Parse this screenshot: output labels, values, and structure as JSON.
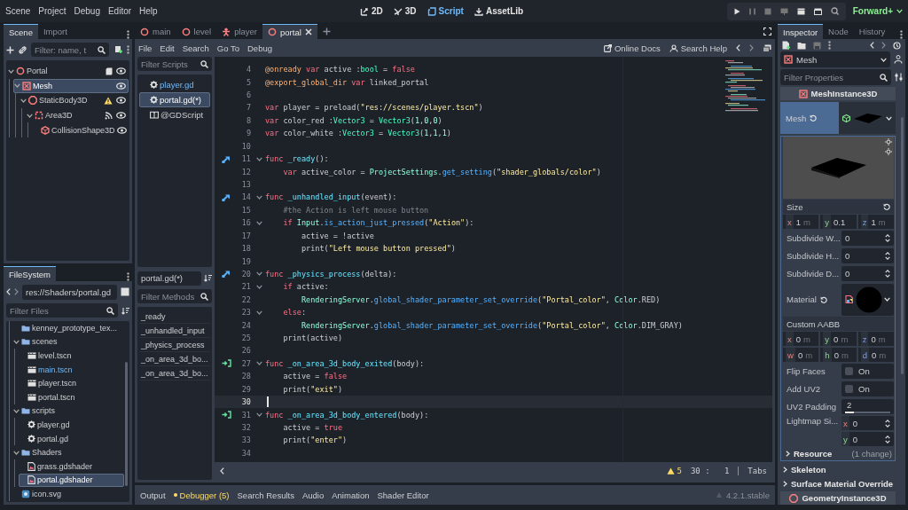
{
  "menu_bar": {
    "menus": [
      "Scene",
      "Project",
      "Debug",
      "Editor",
      "Help"
    ],
    "workspaces": [
      {
        "label": "2D",
        "kind": "canvas",
        "selected": false
      },
      {
        "label": "3D",
        "kind": "spatial",
        "selected": false
      },
      {
        "label": "Script",
        "kind": "script",
        "selected": true
      },
      {
        "label": "AssetLib",
        "kind": "assetlib",
        "selected": false
      }
    ],
    "renderer": "Forward+"
  },
  "scene_dock": {
    "tabs": [
      {
        "label": "Scene",
        "selected": true
      },
      {
        "label": "Import",
        "selected": false
      }
    ],
    "filter": {
      "placeholder": "Filter: name, t"
    },
    "tree": [
      {
        "label": "Portal",
        "kind": "node3d",
        "badge": {
          "kind": "script"
        },
        "selected": false,
        "expanded": true,
        "children": [
          {
            "label": "Mesh",
            "kind": "mesh",
            "selected": true,
            "expanded": true,
            "children": [
              {
                "label": "StaticBody3D",
                "kind": "body",
                "badge": {
                  "kind": "warning"
                },
                "selected": false,
                "expanded": true,
                "children": [
                  {
                    "label": "Area3D",
                    "kind": "area",
                    "badge": {
                      "kind": "signal"
                    },
                    "selected": false,
                    "expanded": true,
                    "children": [
                      {
                        "label": "CollisionShape3D",
                        "kind": "collision",
                        "selected": false
                      }
                    ]
                  }
                ]
              }
            ]
          }
        ]
      }
    ]
  },
  "filesystem": {
    "tabs": [
      {
        "label": "FileSystem",
        "selected": true
      }
    ],
    "path": "res://Shaders/portal.gd",
    "filter": {
      "placeholder": "Filter Files"
    },
    "tree": [
      {
        "label": "kenney_prototype_tex...",
        "kind": "folder",
        "selected": false,
        "highlighted": false
      },
      {
        "label": "scenes",
        "kind": "folder",
        "selected": false,
        "highlighted": false,
        "expanded": true,
        "children": [
          {
            "label": "level.tscn",
            "kind": "scene",
            "selected": false,
            "highlighted": false
          },
          {
            "label": "main.tscn",
            "kind": "scene",
            "selected": false,
            "highlighted": true
          },
          {
            "label": "player.tscn",
            "kind": "scene",
            "selected": false,
            "highlighted": false
          },
          {
            "label": "portal.tscn",
            "kind": "scene",
            "selected": false,
            "highlighted": false
          }
        ]
      },
      {
        "label": "scripts",
        "kind": "folder",
        "selected": false,
        "highlighted": false,
        "expanded": true,
        "children": [
          {
            "label": "player.gd",
            "kind": "script",
            "selected": false,
            "highlighted": false
          },
          {
            "label": "portal.gd",
            "kind": "script",
            "selected": false,
            "highlighted": false
          }
        ]
      },
      {
        "label": "Shaders",
        "kind": "folder",
        "selected": false,
        "highlighted": false,
        "expanded": true,
        "children": [
          {
            "label": "grass.gdshader",
            "kind": "shader",
            "selected": false,
            "highlighted": false
          },
          {
            "label": "portal.gdshader",
            "kind": "shader",
            "selected": true,
            "highlighted": false
          }
        ]
      },
      {
        "label": "icon.svg",
        "kind": "image",
        "selected": false,
        "highlighted": false
      }
    ]
  },
  "script_editor": {
    "scene_tabs": [
      {
        "label": "main",
        "kind": "node3d",
        "selected": false
      },
      {
        "label": "level",
        "kind": "node3d",
        "selected": false
      },
      {
        "label": "player",
        "kind": "character",
        "selected": false
      },
      {
        "label": "portal",
        "kind": "node3d",
        "selected": true
      }
    ],
    "menus": [
      "File",
      "Edit",
      "Search",
      "Go To",
      "Debug"
    ],
    "help_links": [
      {
        "label": "Online Docs",
        "kind": "docs"
      },
      {
        "label": "Search Help",
        "kind": "help"
      }
    ],
    "script_filter": {
      "placeholder": "Filter Scripts"
    },
    "scripts": [
      {
        "label": "player.gd",
        "kind": "script",
        "selected": false,
        "highlighted": true
      },
      {
        "label": "portal.gd(*)",
        "kind": "script",
        "selected": true,
        "highlighted": false
      },
      {
        "label": "@GDScript",
        "kind": "doc",
        "selected": false,
        "highlighted": false
      }
    ],
    "current_script": "portal.gd(*)",
    "method_filter": {
      "placeholder": "Filter Methods"
    },
    "methods": [
      "_ready",
      "_unhandled_input",
      "_physics_process",
      "_on_area_3d_bo...",
      "_on_area_3d_bo..."
    ],
    "code_lines": [
      {
        "number": "4",
        "fold": false,
        "current": false,
        "tokens": [
          {
            "kind": "ann",
            "text": "@onready"
          },
          {
            "kind": "kw",
            "text": " var"
          },
          {
            "kind": "text",
            "text": " active :"
          },
          {
            "kind": "type",
            "text": "bool"
          },
          {
            "kind": "text",
            "text": " = "
          },
          {
            "kind": "kw",
            "text": "false"
          }
        ]
      },
      {
        "number": "5",
        "fold": false,
        "current": false,
        "tokens": [
          {
            "kind": "ann",
            "text": "@export_global_dir"
          },
          {
            "kind": "kw",
            "text": " var"
          },
          {
            "kind": "text",
            "text": " linked_portal"
          }
        ]
      },
      {
        "number": "6",
        "fold": false,
        "current": false
      },
      {
        "number": "7",
        "fold": false,
        "current": false,
        "tokens": [
          {
            "kind": "kw",
            "text": "var"
          },
          {
            "kind": "text",
            "text": " player = preload("
          },
          {
            "kind": "str",
            "text": "\"res://scenes/player.tscn\""
          },
          {
            "kind": "text",
            "text": ")"
          }
        ]
      },
      {
        "number": "8",
        "fold": false,
        "current": false,
        "tokens": [
          {
            "kind": "kw",
            "text": "var"
          },
          {
            "kind": "text",
            "text": " color_red :"
          },
          {
            "kind": "type",
            "text": "Vector3"
          },
          {
            "kind": "text",
            "text": " = "
          },
          {
            "kind": "type",
            "text": "Vector3"
          },
          {
            "kind": "text",
            "text": "("
          },
          {
            "kind": "num",
            "text": "1"
          },
          {
            "kind": "text",
            "text": ","
          },
          {
            "kind": "num",
            "text": "0"
          },
          {
            "kind": "text",
            "text": ","
          },
          {
            "kind": "num",
            "text": "0"
          },
          {
            "kind": "text",
            "text": ")"
          }
        ]
      },
      {
        "number": "9",
        "fold": false,
        "current": false,
        "tokens": [
          {
            "kind": "kw",
            "text": "var"
          },
          {
            "kind": "text",
            "text": " color_white :"
          },
          {
            "kind": "type",
            "text": "Vector3"
          },
          {
            "kind": "text",
            "text": " = "
          },
          {
            "kind": "type",
            "text": "Vector3"
          },
          {
            "kind": "text",
            "text": "("
          },
          {
            "kind": "num",
            "text": "1"
          },
          {
            "kind": "text",
            "text": ","
          },
          {
            "kind": "num",
            "text": "1"
          },
          {
            "kind": "text",
            "text": ","
          },
          {
            "kind": "num",
            "text": "1"
          },
          {
            "kind": "text",
            "text": ")"
          }
        ]
      },
      {
        "number": "10",
        "fold": false,
        "current": false
      },
      {
        "number": "11",
        "fold": true,
        "current": false,
        "gutter_icon": {
          "kind": "override"
        },
        "tokens": [
          {
            "kind": "kw",
            "text": "func"
          },
          {
            "kind": "fndef",
            "text": " _ready"
          },
          {
            "kind": "text",
            "text": "():"
          }
        ]
      },
      {
        "number": "12",
        "fold": false,
        "current": false,
        "tokens": [
          {
            "kind": "kw",
            "text": "\tvar"
          },
          {
            "kind": "text",
            "text": " active_color = "
          },
          {
            "kind": "engine",
            "text": "ProjectSettings"
          },
          {
            "kind": "text",
            "text": "."
          },
          {
            "kind": "fn",
            "text": "get_setting"
          },
          {
            "kind": "text",
            "text": "("
          },
          {
            "kind": "str",
            "text": "\"shader_globals/color\""
          },
          {
            "kind": "text",
            "text": ")"
          }
        ]
      },
      {
        "number": "13",
        "fold": false,
        "current": false
      },
      {
        "number": "14",
        "fold": true,
        "current": false,
        "gutter_icon": {
          "kind": "override"
        },
        "tokens": [
          {
            "kind": "kw",
            "text": "func"
          },
          {
            "kind": "fndef",
            "text": " _unhandled_input"
          },
          {
            "kind": "text",
            "text": "(event):"
          }
        ]
      },
      {
        "number": "15",
        "fold": false,
        "current": false,
        "tokens": [
          {
            "kind": "comment",
            "text": "\t#the Action is left mouse button"
          }
        ]
      },
      {
        "number": "16",
        "fold": true,
        "current": false,
        "tokens": [
          {
            "kind": "kw",
            "text": "\tif"
          },
          {
            "kind": "engine",
            "text": " Input"
          },
          {
            "kind": "text",
            "text": "."
          },
          {
            "kind": "fn",
            "text": "is_action_just_pressed"
          },
          {
            "kind": "text",
            "text": "("
          },
          {
            "kind": "str",
            "text": "\"Action\""
          },
          {
            "kind": "text",
            "text": "):"
          }
        ]
      },
      {
        "number": "17",
        "fold": false,
        "current": false,
        "tokens": [
          {
            "kind": "text",
            "text": "\t\tactive = !active"
          }
        ]
      },
      {
        "number": "18",
        "fold": false,
        "current": false,
        "tokens": [
          {
            "kind": "text",
            "text": "\t\tprint("
          },
          {
            "kind": "str",
            "text": "\"Left mouse button pressed\""
          },
          {
            "kind": "text",
            "text": ")"
          }
        ]
      },
      {
        "number": "19",
        "fold": false,
        "current": false
      },
      {
        "number": "20",
        "fold": true,
        "current": false,
        "gutter_icon": {
          "kind": "override"
        },
        "tokens": [
          {
            "kind": "kw",
            "text": "func"
          },
          {
            "kind": "fndef",
            "text": " _physics_process"
          },
          {
            "kind": "text",
            "text": "(delta):"
          }
        ]
      },
      {
        "number": "21",
        "fold": true,
        "current": false,
        "tokens": [
          {
            "kind": "kw",
            "text": "\tif"
          },
          {
            "kind": "text",
            "text": " active:"
          }
        ]
      },
      {
        "number": "22",
        "fold": false,
        "current": false,
        "tokens": [
          {
            "kind": "engine",
            "text": "\t\tRenderingServer"
          },
          {
            "kind": "text",
            "text": "."
          },
          {
            "kind": "fn",
            "text": "global_shader_parameter_set_override"
          },
          {
            "kind": "text",
            "text": "("
          },
          {
            "kind": "str",
            "text": "\"Portal_color\""
          },
          {
            "kind": "text",
            "text": ", "
          },
          {
            "kind": "engine",
            "text": "Color"
          },
          {
            "kind": "text",
            "text": ".RED)"
          }
        ]
      },
      {
        "number": "23",
        "fold": true,
        "current": false,
        "tokens": [
          {
            "kind": "kw",
            "text": "\telse"
          },
          {
            "kind": "text",
            "text": ":"
          }
        ]
      },
      {
        "number": "24",
        "fold": false,
        "current": false,
        "tokens": [
          {
            "kind": "engine",
            "text": "\t\tRenderingServer"
          },
          {
            "kind": "text",
            "text": "."
          },
          {
            "kind": "fn",
            "text": "global_shader_parameter_set_override"
          },
          {
            "kind": "text",
            "text": "("
          },
          {
            "kind": "str",
            "text": "\"Portal_color\""
          },
          {
            "kind": "text",
            "text": ", "
          },
          {
            "kind": "engine",
            "text": "Color"
          },
          {
            "kind": "text",
            "text": ".DIM_GRAY)"
          }
        ]
      },
      {
        "number": "25",
        "fold": false,
        "current": false,
        "tokens": [
          {
            "kind": "text",
            "text": "\tprint(active)"
          }
        ]
      },
      {
        "number": "26",
        "fold": false,
        "current": false
      },
      {
        "number": "27",
        "fold": true,
        "current": false,
        "gutter_icon": {
          "kind": "signal"
        },
        "tokens": [
          {
            "kind": "kw",
            "text": "func"
          },
          {
            "kind": "fndef",
            "text": " _on_area_3d_body_exited"
          },
          {
            "kind": "text",
            "text": "(body):"
          }
        ]
      },
      {
        "number": "28",
        "fold": false,
        "current": false,
        "tokens": [
          {
            "kind": "text",
            "text": "\tactive = "
          },
          {
            "kind": "kw",
            "text": "false"
          }
        ]
      },
      {
        "number": "29",
        "fold": false,
        "current": false,
        "tokens": [
          {
            "kind": "text",
            "text": "\tprint("
          },
          {
            "kind": "str",
            "text": "\"exit\""
          },
          {
            "kind": "text",
            "text": ")"
          }
        ]
      },
      {
        "number": "30",
        "fold": false,
        "current": true
      },
      {
        "number": "31",
        "fold": true,
        "current": false,
        "gutter_icon": {
          "kind": "signal"
        },
        "tokens": [
          {
            "kind": "kw",
            "text": "func"
          },
          {
            "kind": "fndef",
            "text": " _on_area_3d_body_entered"
          },
          {
            "kind": "text",
            "text": "(body):"
          }
        ]
      },
      {
        "number": "32",
        "fold": false,
        "current": false,
        "tokens": [
          {
            "kind": "text",
            "text": "\tactive = "
          },
          {
            "kind": "kw",
            "text": "true"
          }
        ]
      },
      {
        "number": "33",
        "fold": false,
        "current": false,
        "tokens": [
          {
            "kind": "text",
            "text": "\tprint("
          },
          {
            "kind": "str",
            "text": "\"enter\""
          },
          {
            "kind": "text",
            "text": ")"
          }
        ]
      },
      {
        "number": "34",
        "fold": false,
        "current": false
      }
    ],
    "status": {
      "warnings": "5",
      "position": "30 :   1",
      "indentation": "Tabs"
    }
  },
  "bottom_panel": {
    "tabs": [
      {
        "label": "Output",
        "alert": false
      },
      {
        "label": "Debugger (5)",
        "alert": true
      },
      {
        "label": "Search Results",
        "alert": false
      },
      {
        "label": "Audio",
        "alert": false
      },
      {
        "label": "Animation",
        "alert": false
      },
      {
        "label": "Shader Editor",
        "alert": false
      }
    ],
    "version": "4.2.1.stable"
  },
  "inspector": {
    "tabs": [
      {
        "label": "Inspector",
        "selected": true
      },
      {
        "label": "Node",
        "selected": false
      },
      {
        "label": "History",
        "selected": false
      }
    ],
    "object": "Mesh",
    "filter": {
      "placeholder": "Filter Properties"
    },
    "class_header": "MeshInstance3D",
    "mesh_property": {
      "label": "Mesh"
    },
    "properties": [
      {
        "kind": "vector",
        "label": "Size",
        "revert": true,
        "fields": [
          {
            "axis": "x",
            "value": "1",
            "unit": "m"
          },
          {
            "axis": "y",
            "value": "0.1"
          },
          {
            "axis": "z",
            "value": "1",
            "unit": "m"
          }
        ]
      },
      {
        "kind": "spin",
        "label": "Subdivide W...",
        "value": "0"
      },
      {
        "kind": "spin",
        "label": "Subdivide H...",
        "value": "0"
      },
      {
        "kind": "spin",
        "label": "Subdivide D...",
        "value": "0"
      },
      {
        "kind": "material",
        "label": "Material",
        "revert": true
      },
      {
        "kind": "vector",
        "label": "Custom AABB",
        "fields": [
          {
            "axis": "x",
            "value": "0",
            "unit": "m"
          },
          {
            "axis": "y",
            "value": "0",
            "unit": "m"
          },
          {
            "axis": "z",
            "value": "0",
            "unit": "m"
          },
          {
            "axis": "w",
            "value": "0",
            "unit": "m"
          },
          {
            "axis": "h",
            "value": "0",
            "unit": "m"
          },
          {
            "axis": "d",
            "value": "0",
            "unit": "m"
          }
        ]
      },
      {
        "kind": "check",
        "label": "Flip Faces",
        "checked": false,
        "text": "On"
      },
      {
        "kind": "check",
        "label": "Add UV2",
        "checked": false,
        "text": "On"
      },
      {
        "kind": "slider",
        "label": "UV2 Padding",
        "value": "2",
        "level": 0.2
      },
      {
        "kind": "spin2",
        "label": "Lightmap Si...",
        "fields": [
          {
            "axis": "x",
            "value": "0"
          },
          {
            "axis": "y",
            "value": "0"
          }
        ]
      }
    ],
    "resource_section": {
      "label": "Resource",
      "note": "(1 change)"
    },
    "sections": [
      "Skeleton",
      "Surface Material Override"
    ],
    "footer_header": "GeometryInstance3D"
  }
}
